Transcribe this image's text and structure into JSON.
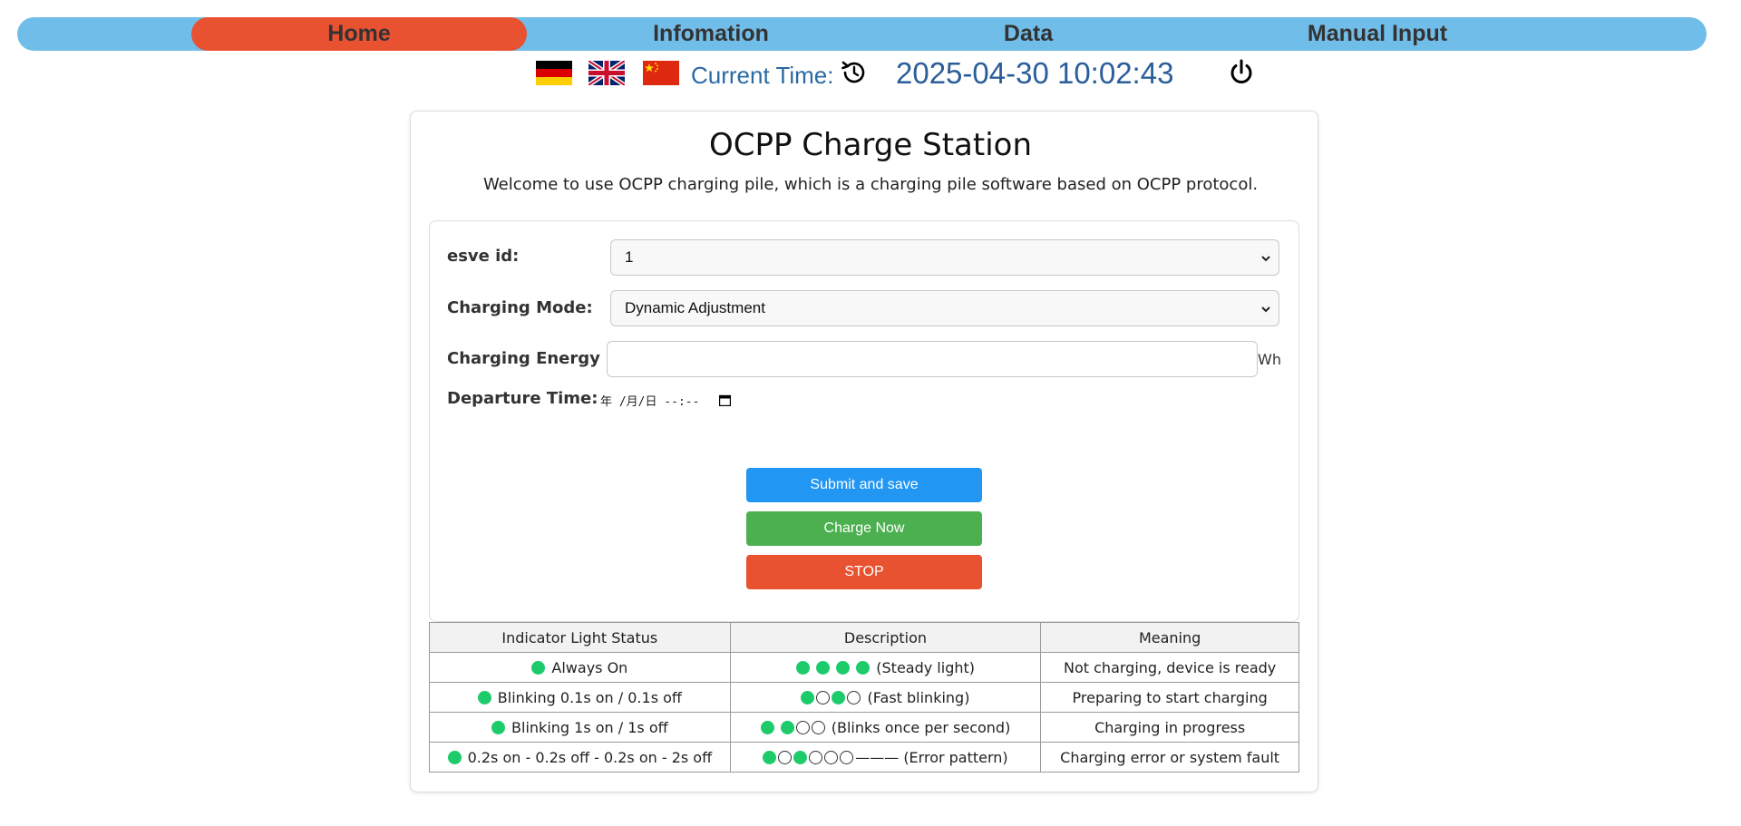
{
  "nav": {
    "home": "Home",
    "information": "Infomation",
    "data": "Data",
    "manual_input": "Manual Input"
  },
  "header": {
    "time_label": "Current Time:",
    "time_value": "2025-04-30 10:02:43"
  },
  "card": {
    "title": "OCPP Charge Station",
    "subtitle": "Welcome to use OCPP charging pile, which is a charging pile software based on OCPP protocol."
  },
  "form": {
    "esve_label": "esve id:",
    "esve_value": "1",
    "mode_label": "Charging Mode:",
    "mode_value": "Dynamic Adjustment",
    "energy_label": "Charging Energy",
    "energy_value": "",
    "energy_unit": "Wh",
    "departure_label": "Departure Time:",
    "departure_placeholder": "年 /月/日  --:--"
  },
  "buttons": {
    "submit": "Submit and save",
    "charge": "Charge Now",
    "stop": "STOP"
  },
  "table": {
    "headers": [
      "Indicator Light Status",
      "Description",
      "Meaning"
    ],
    "rows": [
      {
        "status": "Always On",
        "description": "(Steady light)",
        "meaning": "Not charging, device is ready"
      },
      {
        "status": "Blinking 0.1s on / 0.1s off",
        "description": "(Fast blinking)",
        "meaning": "Preparing to start charging"
      },
      {
        "status": "Blinking 1s on / 1s off",
        "description": "(Blinks once per second)",
        "meaning": "Charging in progress"
      },
      {
        "status": "0.2s on - 0.2s off - 0.2s on - 2s off",
        "description": "(Error pattern)",
        "meaning": "Charging error or system fault"
      }
    ],
    "error_dash": "———"
  },
  "colors": {
    "nav_bg": "#71bdea",
    "nav_active": "#e95230",
    "led_on": "#1ecb6b",
    "btn_blue": "#2196f3",
    "btn_green": "#4caf50",
    "btn_red": "#e95230"
  },
  "icons": [
    "flag-germany-icon",
    "flag-uk-icon",
    "flag-china-icon",
    "sync-time-icon",
    "power-icon",
    "chevron-down-icon",
    "calendar-icon"
  ]
}
